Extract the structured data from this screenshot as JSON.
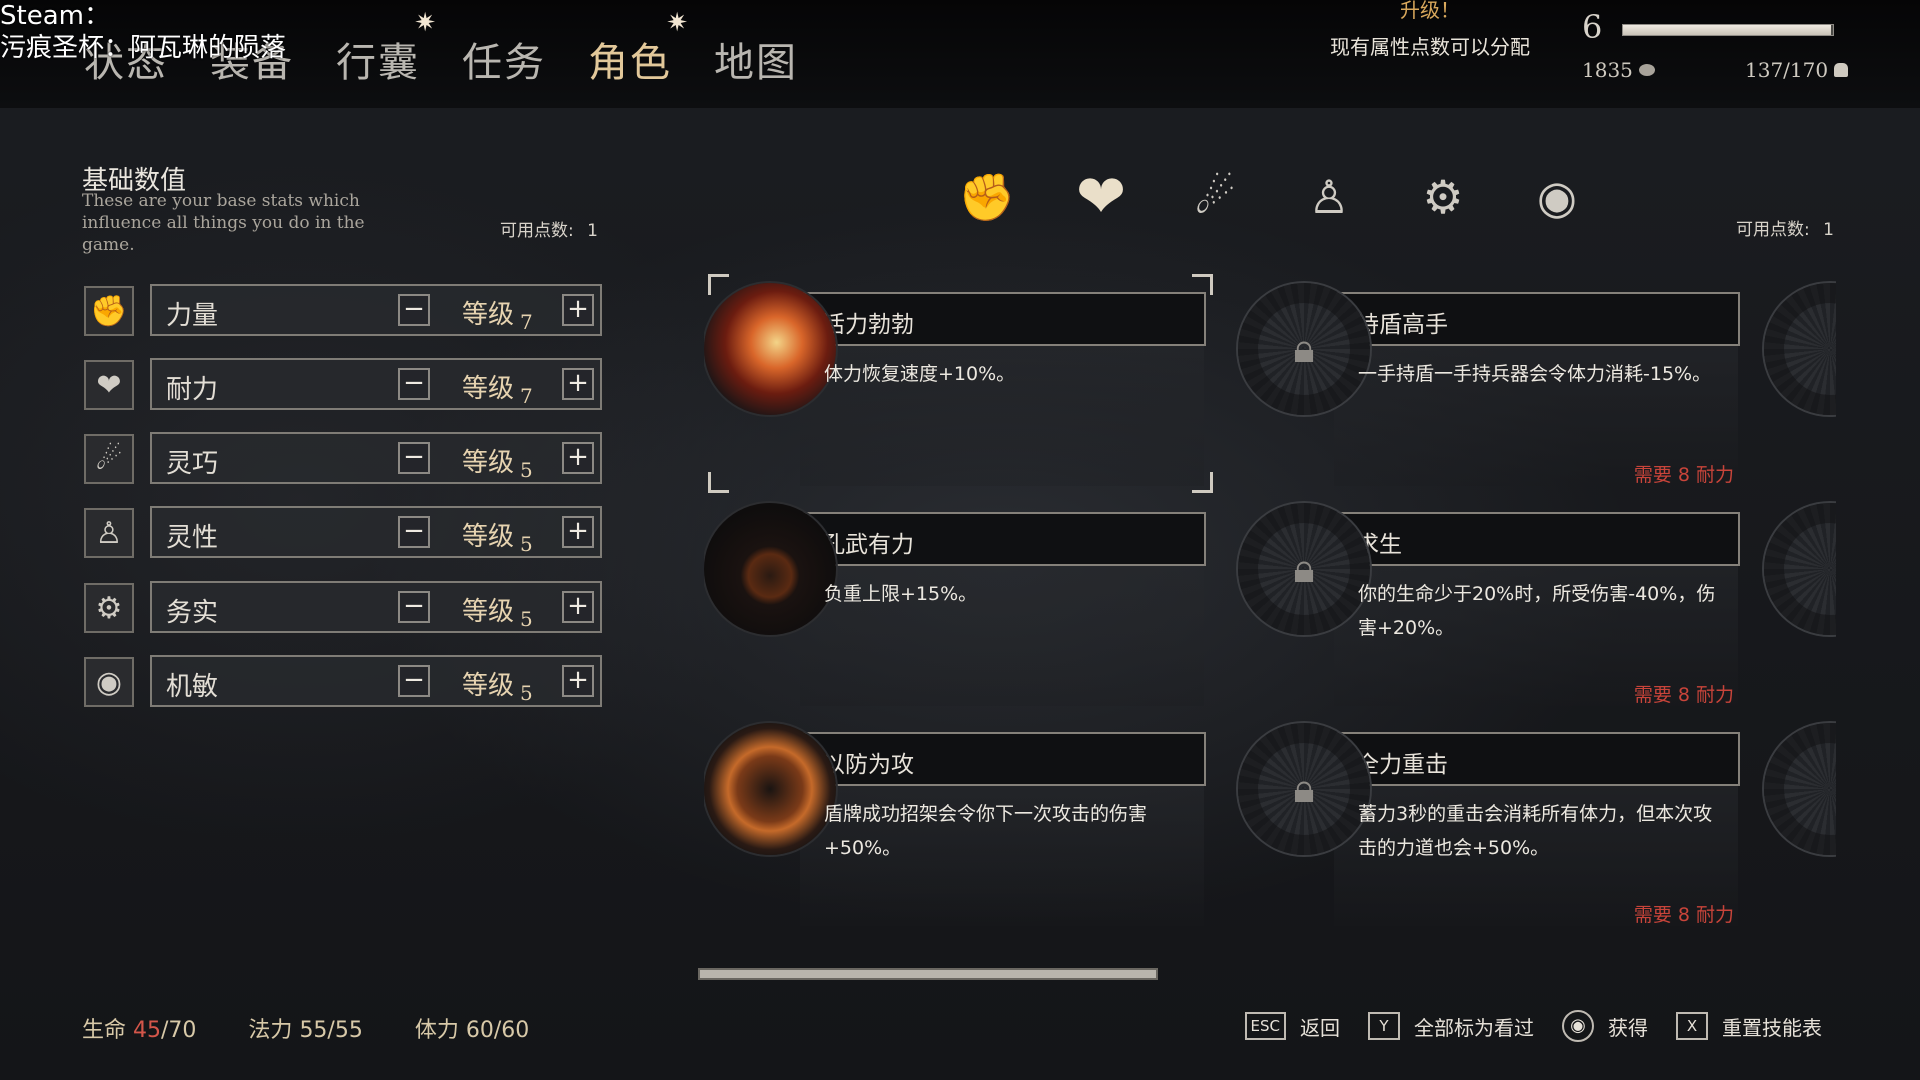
{
  "overlay": {
    "line1": "Steam：",
    "line2": "污痕圣杯：阿瓦琳的陨落"
  },
  "tabs": [
    {
      "label": "状态",
      "star": false,
      "active": false
    },
    {
      "label": "装备",
      "star": false,
      "active": false
    },
    {
      "label": "行囊",
      "star": true,
      "active": false
    },
    {
      "label": "任务",
      "star": false,
      "active": false
    },
    {
      "label": "角色",
      "star": true,
      "active": true
    },
    {
      "label": "地图",
      "star": false,
      "active": false
    }
  ],
  "tab_star_glyph": "✷",
  "level_up": {
    "title": "升级！",
    "message": "现有属性点数可以分配"
  },
  "player": {
    "level": "6",
    "xp_fraction": 0.99,
    "gold": "1835",
    "weight": "137/170"
  },
  "base_stats": {
    "title": "基础数值",
    "description": "These are your base stats which influence all things you do in the game.",
    "available_label": "可用点数:",
    "available_value": "1",
    "level_label": "等级",
    "stats": [
      {
        "name": "力量",
        "level": "7",
        "icon": "fist-icon"
      },
      {
        "name": "耐力",
        "level": "7",
        "icon": "heart-shield-icon"
      },
      {
        "name": "灵巧",
        "level": "5",
        "icon": "acrobat-icon"
      },
      {
        "name": "灵性",
        "level": "5",
        "icon": "meditate-icon"
      },
      {
        "name": "务实",
        "level": "5",
        "icon": "gear-icon"
      },
      {
        "name": "机敏",
        "level": "5",
        "icon": "eye-icon"
      }
    ]
  },
  "categories": [
    "fist-icon",
    "heart-shield-icon",
    "acrobat-icon",
    "meditate-icon",
    "gear-icon",
    "eye-icon"
  ],
  "skills_available": {
    "label": "可用点数:",
    "value": "1"
  },
  "skills": [
    {
      "name": "活力勃勃",
      "desc": "体力恢复速度+10%。",
      "locked": false,
      "req": "",
      "orb": "fire"
    },
    {
      "name": "持盾高手",
      "desc": "一手持盾一手持兵器会令体力消耗-15%。",
      "locked": true,
      "req": "需要 8 耐力",
      "orb": "locked"
    },
    {
      "name": "孔武有力",
      "desc": "负重上限+15%。",
      "locked": false,
      "req": "",
      "orb": "dark"
    },
    {
      "name": "求生",
      "desc": "你的生命少于20%时，所受伤害-40%，伤害+20%。",
      "locked": true,
      "req": "需要 8 耐力",
      "orb": "locked"
    },
    {
      "name": "以防为攻",
      "desc": "盾牌成功招架会令你下一次攻击的伤害+50%。",
      "locked": false,
      "req": "",
      "orb": "ember"
    },
    {
      "name": "全力重击",
      "desc": "蓄力3秒的重击会消耗所有体力，但本次攻击的力道也会+50%。",
      "locked": true,
      "req": "需要 8 耐力",
      "orb": "locked"
    }
  ],
  "vitals": {
    "hp_label": "生命",
    "hp_current": "45",
    "hp_max": "/70",
    "mp_label": "法力",
    "mp_value": "55/55",
    "sp_label": "体力",
    "sp_value": "60/60"
  },
  "hints": [
    {
      "key": "ESC",
      "label": "返回"
    },
    {
      "key": "Y",
      "label": "全部标为看过"
    },
    {
      "key": "◉",
      "label": "获得"
    },
    {
      "key": "X",
      "label": "重置技能表"
    }
  ]
}
